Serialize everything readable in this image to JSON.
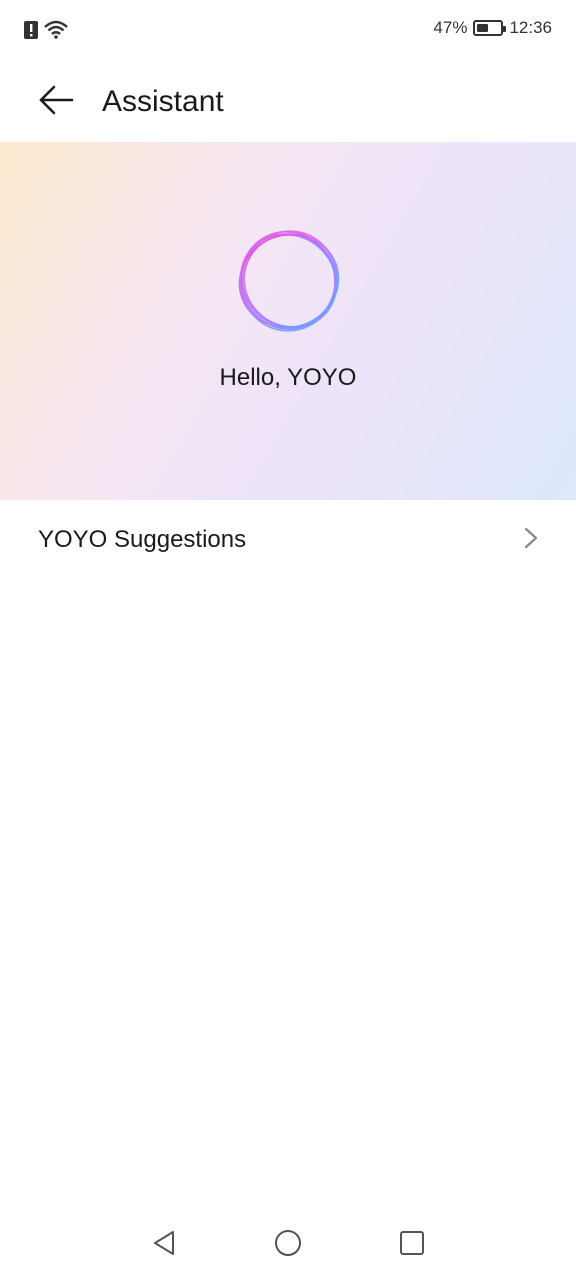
{
  "status_bar": {
    "battery_percent": "47%",
    "battery_level": 0.47,
    "time": "12:36",
    "icons": [
      "alert-icon",
      "wifi-icon",
      "battery-icon"
    ]
  },
  "header": {
    "title": "Assistant",
    "back_icon": "back-arrow-icon"
  },
  "hero": {
    "greeting": "Hello, YOYO",
    "orb_colors": [
      "#ff4fd8",
      "#a46bff",
      "#4fb8ff"
    ]
  },
  "list": {
    "items": [
      {
        "label": "YOYO Suggestions",
        "icon": "chevron-right-icon"
      }
    ]
  },
  "nav_bar": {
    "icons": [
      "back-triangle-icon",
      "home-circle-icon",
      "recents-square-icon"
    ]
  }
}
